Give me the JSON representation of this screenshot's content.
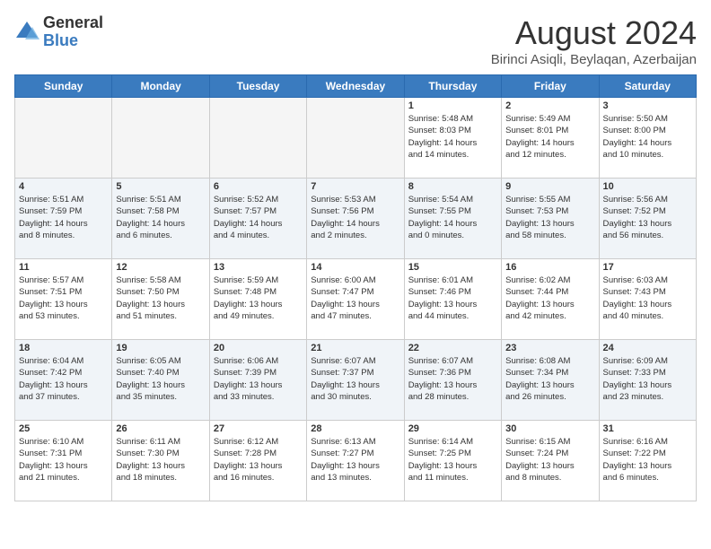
{
  "header": {
    "logo_general": "General",
    "logo_blue": "Blue",
    "month_year": "August 2024",
    "location": "Birinci Asiqli, Beylaqan, Azerbaijan"
  },
  "days_of_week": [
    "Sunday",
    "Monday",
    "Tuesday",
    "Wednesday",
    "Thursday",
    "Friday",
    "Saturday"
  ],
  "weeks": [
    {
      "row_alt": false,
      "cells": [
        {
          "day": "",
          "empty": true,
          "content": ""
        },
        {
          "day": "",
          "empty": true,
          "content": ""
        },
        {
          "day": "",
          "empty": true,
          "content": ""
        },
        {
          "day": "",
          "empty": true,
          "content": ""
        },
        {
          "day": "1",
          "empty": false,
          "content": "Sunrise: 5:48 AM\nSunset: 8:03 PM\nDaylight: 14 hours\nand 14 minutes."
        },
        {
          "day": "2",
          "empty": false,
          "content": "Sunrise: 5:49 AM\nSunset: 8:01 PM\nDaylight: 14 hours\nand 12 minutes."
        },
        {
          "day": "3",
          "empty": false,
          "content": "Sunrise: 5:50 AM\nSunset: 8:00 PM\nDaylight: 14 hours\nand 10 minutes."
        }
      ]
    },
    {
      "row_alt": true,
      "cells": [
        {
          "day": "4",
          "empty": false,
          "content": "Sunrise: 5:51 AM\nSunset: 7:59 PM\nDaylight: 14 hours\nand 8 minutes."
        },
        {
          "day": "5",
          "empty": false,
          "content": "Sunrise: 5:51 AM\nSunset: 7:58 PM\nDaylight: 14 hours\nand 6 minutes."
        },
        {
          "day": "6",
          "empty": false,
          "content": "Sunrise: 5:52 AM\nSunset: 7:57 PM\nDaylight: 14 hours\nand 4 minutes."
        },
        {
          "day": "7",
          "empty": false,
          "content": "Sunrise: 5:53 AM\nSunset: 7:56 PM\nDaylight: 14 hours\nand 2 minutes."
        },
        {
          "day": "8",
          "empty": false,
          "content": "Sunrise: 5:54 AM\nSunset: 7:55 PM\nDaylight: 14 hours\nand 0 minutes."
        },
        {
          "day": "9",
          "empty": false,
          "content": "Sunrise: 5:55 AM\nSunset: 7:53 PM\nDaylight: 13 hours\nand 58 minutes."
        },
        {
          "day": "10",
          "empty": false,
          "content": "Sunrise: 5:56 AM\nSunset: 7:52 PM\nDaylight: 13 hours\nand 56 minutes."
        }
      ]
    },
    {
      "row_alt": false,
      "cells": [
        {
          "day": "11",
          "empty": false,
          "content": "Sunrise: 5:57 AM\nSunset: 7:51 PM\nDaylight: 13 hours\nand 53 minutes."
        },
        {
          "day": "12",
          "empty": false,
          "content": "Sunrise: 5:58 AM\nSunset: 7:50 PM\nDaylight: 13 hours\nand 51 minutes."
        },
        {
          "day": "13",
          "empty": false,
          "content": "Sunrise: 5:59 AM\nSunset: 7:48 PM\nDaylight: 13 hours\nand 49 minutes."
        },
        {
          "day": "14",
          "empty": false,
          "content": "Sunrise: 6:00 AM\nSunset: 7:47 PM\nDaylight: 13 hours\nand 47 minutes."
        },
        {
          "day": "15",
          "empty": false,
          "content": "Sunrise: 6:01 AM\nSunset: 7:46 PM\nDaylight: 13 hours\nand 44 minutes."
        },
        {
          "day": "16",
          "empty": false,
          "content": "Sunrise: 6:02 AM\nSunset: 7:44 PM\nDaylight: 13 hours\nand 42 minutes."
        },
        {
          "day": "17",
          "empty": false,
          "content": "Sunrise: 6:03 AM\nSunset: 7:43 PM\nDaylight: 13 hours\nand 40 minutes."
        }
      ]
    },
    {
      "row_alt": true,
      "cells": [
        {
          "day": "18",
          "empty": false,
          "content": "Sunrise: 6:04 AM\nSunset: 7:42 PM\nDaylight: 13 hours\nand 37 minutes."
        },
        {
          "day": "19",
          "empty": false,
          "content": "Sunrise: 6:05 AM\nSunset: 7:40 PM\nDaylight: 13 hours\nand 35 minutes."
        },
        {
          "day": "20",
          "empty": false,
          "content": "Sunrise: 6:06 AM\nSunset: 7:39 PM\nDaylight: 13 hours\nand 33 minutes."
        },
        {
          "day": "21",
          "empty": false,
          "content": "Sunrise: 6:07 AM\nSunset: 7:37 PM\nDaylight: 13 hours\nand 30 minutes."
        },
        {
          "day": "22",
          "empty": false,
          "content": "Sunrise: 6:07 AM\nSunset: 7:36 PM\nDaylight: 13 hours\nand 28 minutes."
        },
        {
          "day": "23",
          "empty": false,
          "content": "Sunrise: 6:08 AM\nSunset: 7:34 PM\nDaylight: 13 hours\nand 26 minutes."
        },
        {
          "day": "24",
          "empty": false,
          "content": "Sunrise: 6:09 AM\nSunset: 7:33 PM\nDaylight: 13 hours\nand 23 minutes."
        }
      ]
    },
    {
      "row_alt": false,
      "cells": [
        {
          "day": "25",
          "empty": false,
          "content": "Sunrise: 6:10 AM\nSunset: 7:31 PM\nDaylight: 13 hours\nand 21 minutes."
        },
        {
          "day": "26",
          "empty": false,
          "content": "Sunrise: 6:11 AM\nSunset: 7:30 PM\nDaylight: 13 hours\nand 18 minutes."
        },
        {
          "day": "27",
          "empty": false,
          "content": "Sunrise: 6:12 AM\nSunset: 7:28 PM\nDaylight: 13 hours\nand 16 minutes."
        },
        {
          "day": "28",
          "empty": false,
          "content": "Sunrise: 6:13 AM\nSunset: 7:27 PM\nDaylight: 13 hours\nand 13 minutes."
        },
        {
          "day": "29",
          "empty": false,
          "content": "Sunrise: 6:14 AM\nSunset: 7:25 PM\nDaylight: 13 hours\nand 11 minutes."
        },
        {
          "day": "30",
          "empty": false,
          "content": "Sunrise: 6:15 AM\nSunset: 7:24 PM\nDaylight: 13 hours\nand 8 minutes."
        },
        {
          "day": "31",
          "empty": false,
          "content": "Sunrise: 6:16 AM\nSunset: 7:22 PM\nDaylight: 13 hours\nand 6 minutes."
        }
      ]
    }
  ]
}
